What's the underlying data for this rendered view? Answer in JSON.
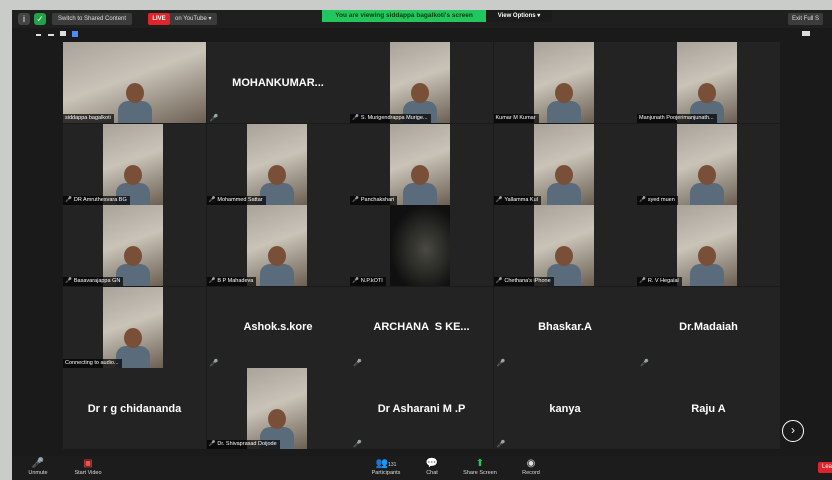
{
  "topbar": {
    "share_label": "Switch to Shared Content",
    "live_label": "LIVE",
    "youtube_label": "on YouTube",
    "viewing_label": "You are viewing siddappa bagalkoti's screen",
    "view_options_label": "View Options",
    "exit_label": "Exit Full S"
  },
  "participants": [
    {
      "name": "siddappa bagalkoti",
      "type": "video",
      "active": true,
      "mute": false
    },
    {
      "name": "MOHANKUMAR...",
      "type": "name",
      "mute": true
    },
    {
      "name": "S. Murigendrappa Murige...",
      "type": "video",
      "mute": true
    },
    {
      "name": "Kumar M Kumar",
      "type": "video",
      "mute": false
    },
    {
      "name": "Manjunath Poojerimanjunath...",
      "type": "video",
      "mute": false
    },
    {
      "name": "DR Amruthesvara BG",
      "type": "video",
      "mute": true
    },
    {
      "name": "Mohammed Sattar",
      "type": "video",
      "mute": true
    },
    {
      "name": "Panchakshari",
      "type": "video",
      "mute": true
    },
    {
      "name": "Yallamma Kul",
      "type": "video",
      "mute": true
    },
    {
      "name": "syed muen",
      "type": "video",
      "mute": true
    },
    {
      "name": "Basavarajappa GN",
      "type": "video",
      "mute": true
    },
    {
      "name": "B P Mahadeva",
      "type": "video",
      "mute": true
    },
    {
      "name": "N.P.kOTI",
      "type": "video",
      "mute": true
    },
    {
      "name": "Chethana's iPhone",
      "type": "video",
      "mute": true
    },
    {
      "name": "R. V Hegalal",
      "type": "video",
      "mute": true
    },
    {
      "name": "Connecting to audio...",
      "type": "video",
      "mute": false
    },
    {
      "name": "Ashok.s.kore",
      "type": "name",
      "mute": true
    },
    {
      "name": "ARCHANA  S KE...",
      "type": "name",
      "mute": true
    },
    {
      "name": "Bhaskar.A",
      "type": "name",
      "mute": true
    },
    {
      "name": "Dr.Madaiah",
      "type": "name",
      "mute": true
    },
    {
      "name": "Dr r g chidananda",
      "type": "name",
      "mute": false
    },
    {
      "name": "Dr. Shivaprasad Doijode",
      "type": "video",
      "mute": true
    },
    {
      "name": "Dr Asharani M .P",
      "type": "name",
      "mute": true
    },
    {
      "name": "kanya",
      "type": "name",
      "mute": true
    },
    {
      "name": "Raju A",
      "type": "name",
      "mute": false
    }
  ],
  "bottombar": {
    "unmute": "Unmute",
    "start_video": "Start Video",
    "participants": "Participants",
    "participants_count": "131",
    "chat": "Chat",
    "share_screen": "Share Screen",
    "record": "Record",
    "leave": "Lea"
  },
  "colors": {
    "active_border": "#b9e24a",
    "live": "#e0242c",
    "viewing_banner": "#22c55e"
  }
}
